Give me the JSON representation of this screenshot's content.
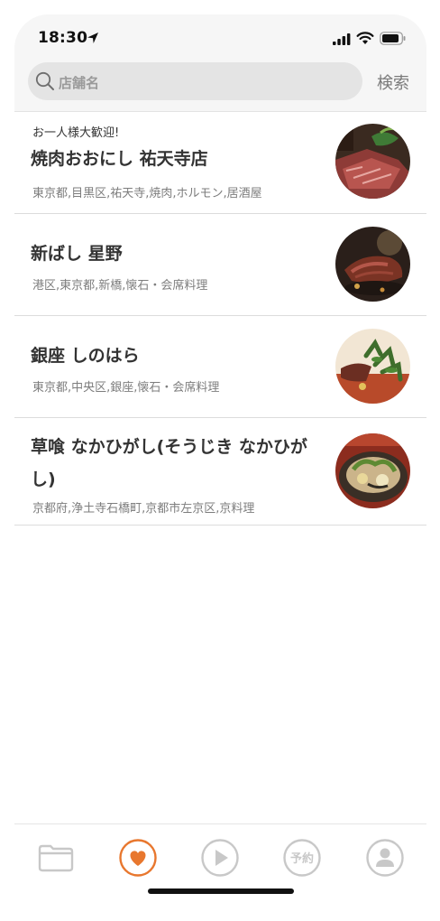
{
  "status_bar": {
    "time": "18:30"
  },
  "search": {
    "placeholder": "店舗名",
    "button_label": "検索"
  },
  "restaurants": [
    {
      "tag": "お一人様大歓迎!",
      "name": "焼肉おおにし 祐天寺店",
      "meta": "東京都,目黒区,祐天寺,焼肉,ホルモン,居酒屋",
      "image": "grilled-meat-photo"
    },
    {
      "tag": "",
      "name": "新ばし 星野",
      "meta": "港区,東京都,新橋,懐石・会席料理",
      "image": "roast-dish-photo"
    },
    {
      "tag": "",
      "name": "銀座 しのはら",
      "meta": "東京都,中央区,銀座,懐石・会席料理",
      "image": "plated-greens-photo"
    },
    {
      "tag": "",
      "name": "草喰 なかひがし(そうじき なかひがし)",
      "meta": "京都府,浄土寺石橋町,京都市左京区,京料理",
      "image": "kyoto-cuisine-photo"
    }
  ],
  "tab_bar": {
    "items": [
      {
        "icon": "folder-icon",
        "active": false
      },
      {
        "icon": "heart-icon",
        "active": true
      },
      {
        "icon": "play-icon",
        "active": false
      },
      {
        "icon": "reservation-icon",
        "label": "予約",
        "active": false
      },
      {
        "icon": "profile-icon",
        "active": false
      }
    ]
  },
  "colors": {
    "accent": "#e8772e",
    "inactive": "#c8c8c8",
    "text": "#333333"
  }
}
